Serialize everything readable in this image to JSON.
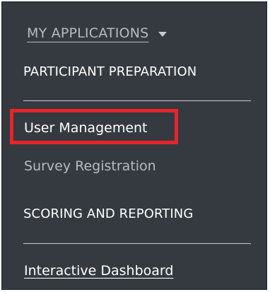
{
  "menu": {
    "apps_label": "MY APPLICATIONS",
    "sections": [
      {
        "heading": "PARTICIPANT PREPARATION",
        "items": [
          {
            "label": "User Management"
          },
          {
            "label": "Survey Registration"
          }
        ]
      },
      {
        "heading": "SCORING AND REPORTING",
        "items": [
          {
            "label": "Interactive Dashboard"
          }
        ]
      }
    ]
  },
  "colors": {
    "panel_background": "#343a40",
    "highlight": "#e8232a",
    "text_primary": "#ffffff",
    "text_muted": "#b8bcc2"
  },
  "icons": {
    "apps_toggle": "caret-down-icon"
  }
}
